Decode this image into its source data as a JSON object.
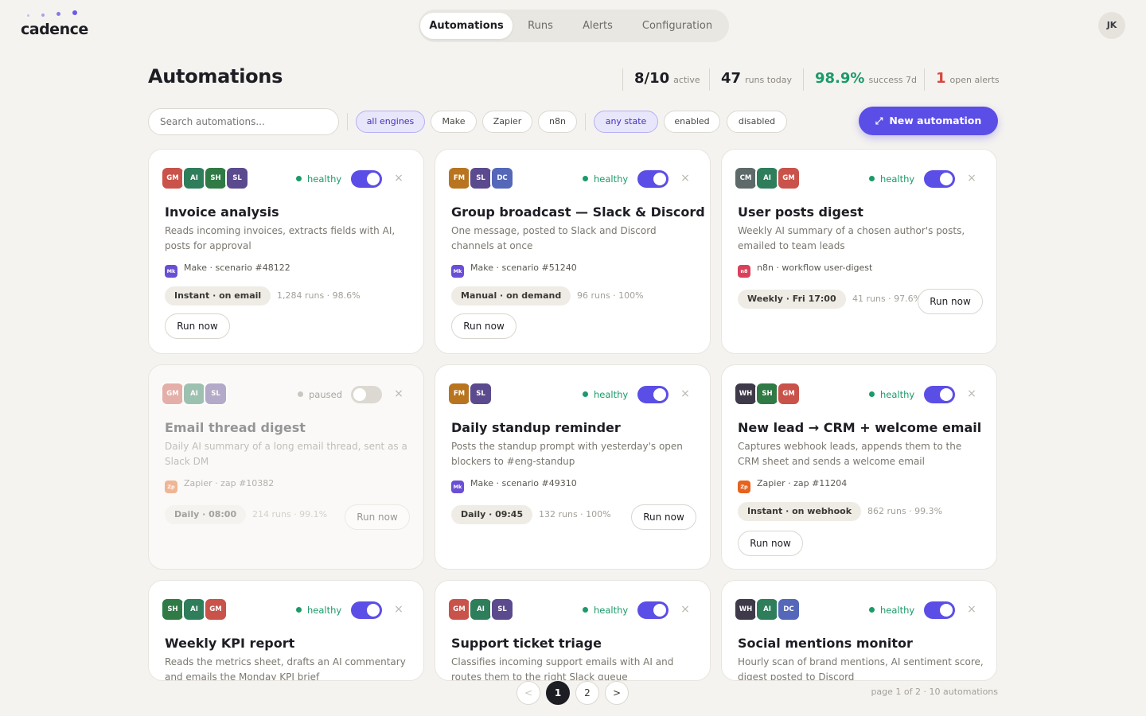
{
  "app": {
    "name": "cadence",
    "user_initials": "JK"
  },
  "nav": {
    "tabs": [
      {
        "label": "Automations",
        "active": true
      },
      {
        "label": "Runs",
        "active": false
      },
      {
        "label": "Alerts",
        "active": false
      },
      {
        "label": "Configuration",
        "active": false
      }
    ]
  },
  "page": {
    "title": "Automations"
  },
  "stats": [
    {
      "value": "8/10",
      "label": "active",
      "tone": "default"
    },
    {
      "value": "47",
      "label": "runs today",
      "tone": "default"
    },
    {
      "value": "98.9%",
      "label": "success 7d",
      "tone": "green"
    },
    {
      "value": "1",
      "label": "open alerts",
      "tone": "red"
    }
  ],
  "filters": {
    "search_placeholder": "Search automations...",
    "engines": [
      {
        "label": "all engines",
        "selected": true
      },
      {
        "label": "Make",
        "selected": false
      },
      {
        "label": "Zapier",
        "selected": false
      },
      {
        "label": "n8n",
        "selected": false
      }
    ],
    "states": [
      {
        "label": "any state",
        "selected": true
      },
      {
        "label": "enabled",
        "selected": false
      },
      {
        "label": "disabled",
        "selected": false
      }
    ],
    "new_button": "New automation"
  },
  "colors": {
    "accent": "#5b4ee6",
    "healthy": "#1b9a6a",
    "alert": "#d6473d",
    "GM": "#c9524a",
    "AI": "#2e7d5b",
    "SH": "#2f7a45",
    "SL": "#5b4a8e",
    "FM": "#b8741f",
    "DC": "#5467b8",
    "CM": "#5e6a6a",
    "WH": "#3f3a4a",
    "Make": "#6a4fd6",
    "n8n": "#d9415a",
    "Zapier": "#e6631f"
  },
  "cards": [
    {
      "name": "Invoice analysis",
      "description": "Reads incoming invoices, extracts fields with AI, posts for approval",
      "apps": [
        "GM",
        "AI",
        "SH",
        "SL"
      ],
      "status": "healthy",
      "enabled": true,
      "engine": "Make",
      "engine_badge": "Mk",
      "source": "Make · scenario #48122",
      "schedule": "Instant · on email",
      "meta": "1,284 runs · 98.6%",
      "run_label": "Run now"
    },
    {
      "name": "Group broadcast — Slack & Discord",
      "description": "One message, posted to Slack and Discord channels at once",
      "apps": [
        "FM",
        "SL",
        "DC"
      ],
      "status": "healthy",
      "enabled": true,
      "engine": "Make",
      "engine_badge": "Mk",
      "source": "Make · scenario #51240",
      "schedule": "Manual · on demand",
      "meta": "96 runs · 100%",
      "run_label": "Run now"
    },
    {
      "name": "User posts digest",
      "description": "Weekly AI summary of a chosen author's posts, emailed to team leads",
      "apps": [
        "CM",
        "AI",
        "GM"
      ],
      "status": "healthy",
      "enabled": true,
      "engine": "n8n",
      "engine_badge": "n8",
      "source": "n8n · workflow user-digest",
      "schedule": "Weekly · Fri 17:00",
      "meta": "41 runs · 97.6%",
      "run_label": "Run now"
    },
    {
      "name": "Email thread digest",
      "description": "Daily AI summary of a long email thread, sent as a Slack DM",
      "apps": [
        "GM",
        "AI",
        "SL"
      ],
      "status": "paused",
      "enabled": false,
      "engine": "Zapier",
      "engine_badge": "Zp",
      "source": "Zapier · zap #10382",
      "schedule": "Daily · 08:00",
      "meta": "214 runs · 99.1%",
      "run_label": "Run now"
    },
    {
      "name": "Daily standup reminder",
      "description": "Posts the standup prompt with yesterday's open blockers to #eng-standup",
      "apps": [
        "FM",
        "SL"
      ],
      "status": "healthy",
      "enabled": true,
      "engine": "Make",
      "engine_badge": "Mk",
      "source": "Make · scenario #49310",
      "schedule": "Daily · 09:45",
      "meta": "132 runs · 100%",
      "run_label": "Run now"
    },
    {
      "name": "New lead → CRM + welcome email",
      "description": "Captures webhook leads, appends them to the CRM sheet and sends a welcome email",
      "apps": [
        "WH",
        "SH",
        "GM"
      ],
      "status": "healthy",
      "enabled": true,
      "engine": "Zapier",
      "engine_badge": "Zp",
      "source": "Zapier · zap #11204",
      "schedule": "Instant · on webhook",
      "meta": "862 runs · 99.3%",
      "run_label": "Run now"
    },
    {
      "name": "Weekly KPI report",
      "description": "Reads the metrics sheet, drafts an AI commentary and emails the Monday KPI brief",
      "apps": [
        "SH",
        "AI",
        "GM"
      ],
      "status": "healthy",
      "enabled": true
    },
    {
      "name": "Support ticket triage",
      "description": "Classifies incoming support emails with AI and routes them to the right Slack queue",
      "apps": [
        "GM",
        "AI",
        "SL"
      ],
      "status": "healthy",
      "enabled": true
    },
    {
      "name": "Social mentions monitor",
      "description": "Hourly scan of brand mentions, AI sentiment score, digest posted to Discord",
      "apps": [
        "WH",
        "AI",
        "DC"
      ],
      "status": "healthy",
      "enabled": true
    }
  ],
  "pagination": {
    "prev": "<",
    "next": ">",
    "pages": [
      "1",
      "2"
    ],
    "current": "1",
    "info": "page 1 of 2 · 10 automations"
  }
}
